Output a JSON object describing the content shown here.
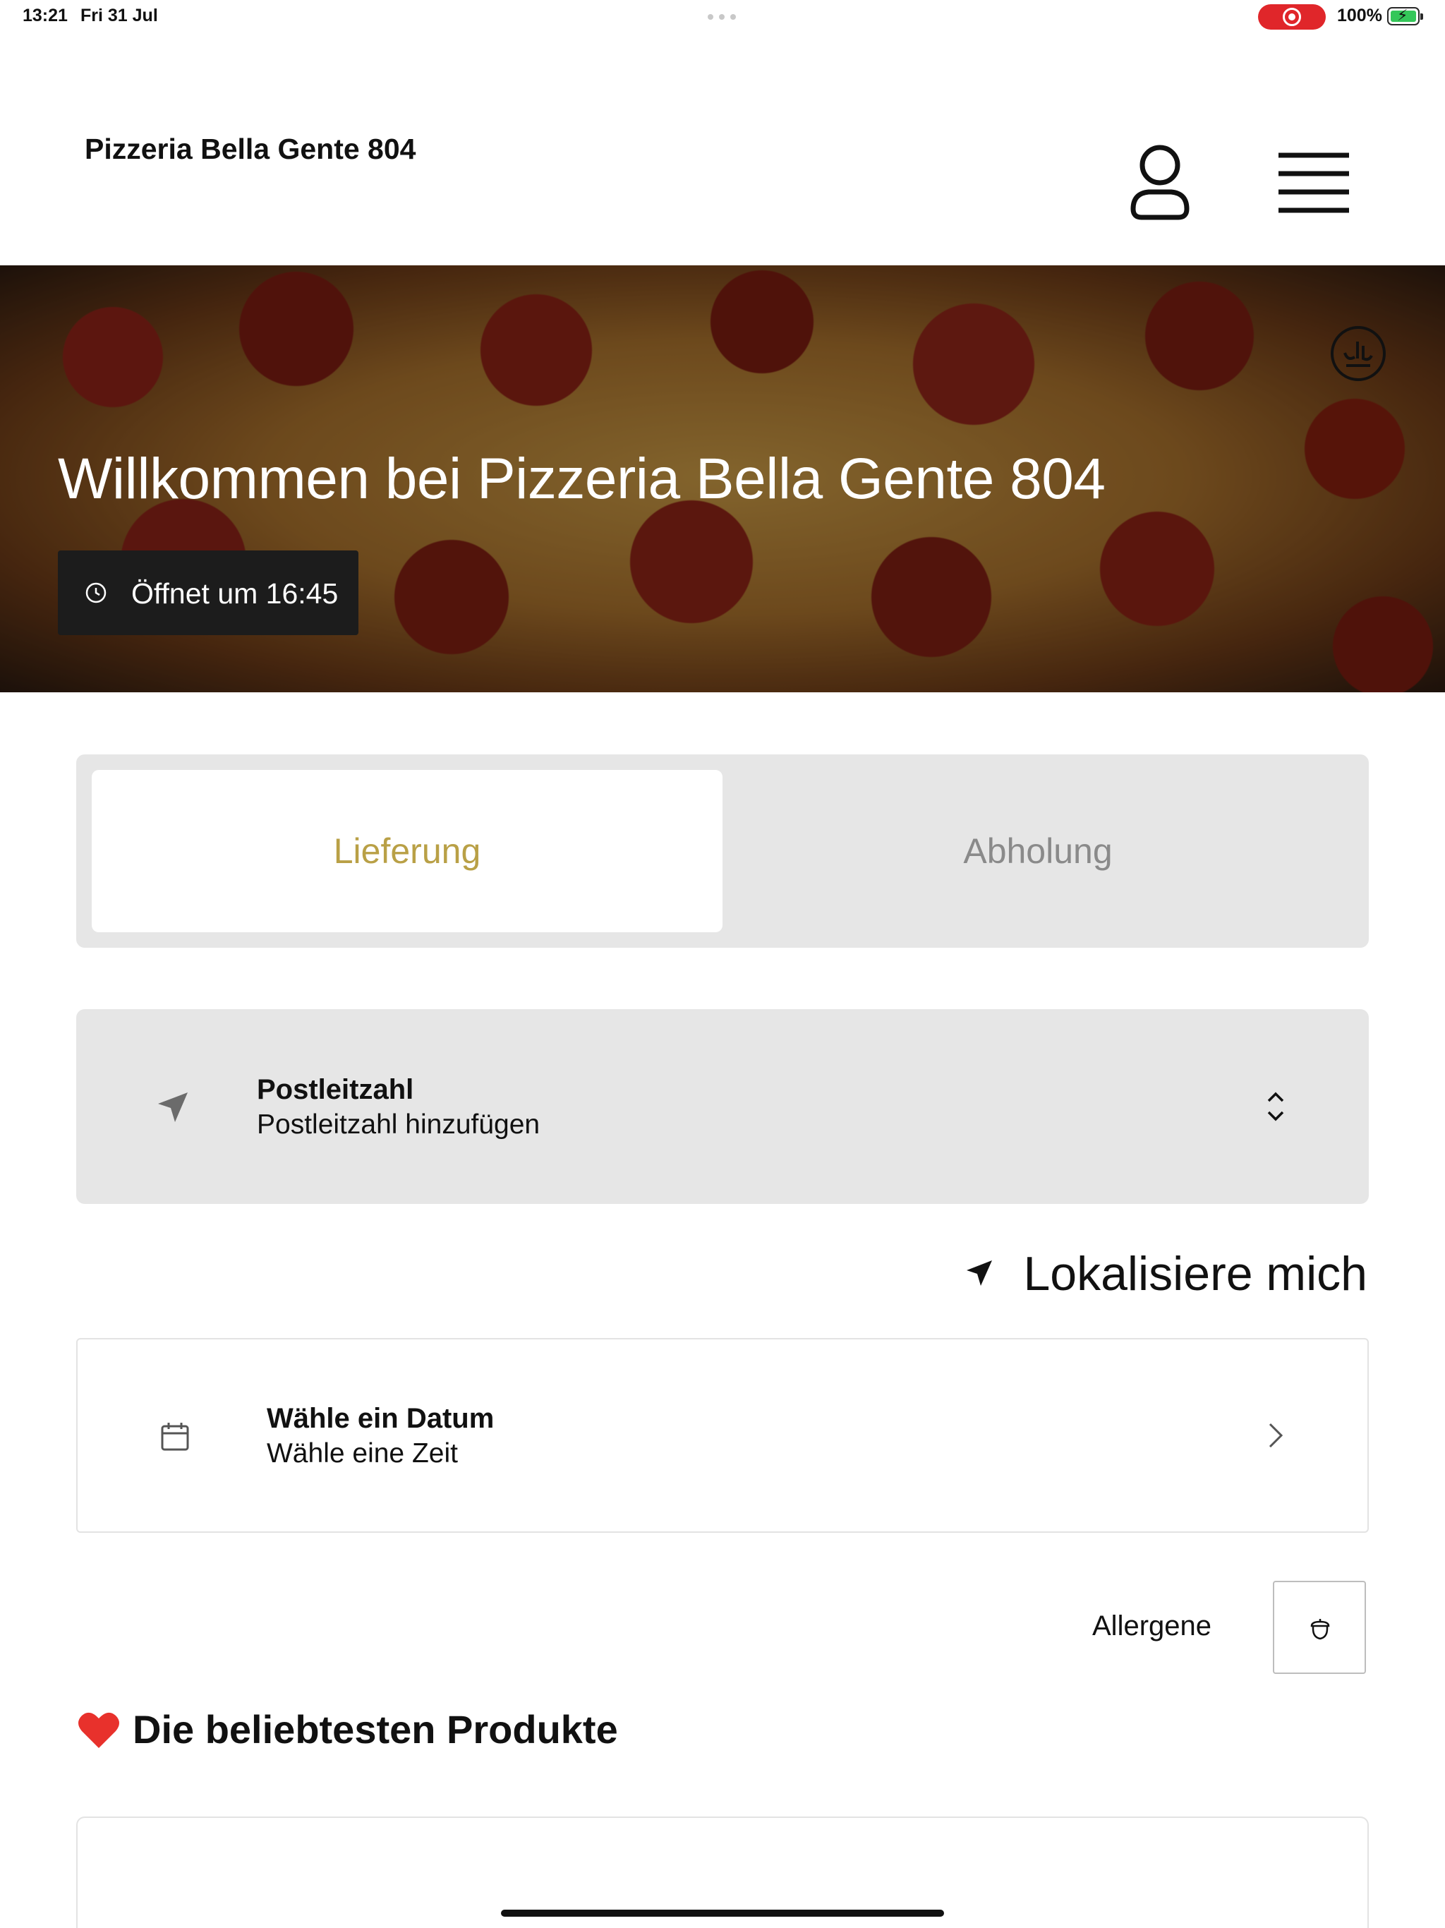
{
  "status_bar": {
    "time": "13:21",
    "date": "Fri 31 Jul",
    "battery": "100%",
    "recording_color": "#e0262a",
    "battery_fill_color": "#34c759"
  },
  "header": {
    "brand": "Pizzeria Bella Gente 804",
    "profile_icon": "user-icon",
    "menu_icon": "hamburger-menu-icon"
  },
  "hero": {
    "title": "Willkommen bei Pizzeria Bella Gente 804",
    "open_badge": "Öffnet um 16:45",
    "halal_icon": "halal-icon"
  },
  "order_mode": {
    "tabs": [
      {
        "label": "Lieferung",
        "selected": true
      },
      {
        "label": "Abholung",
        "selected": false
      }
    ],
    "accent_color": "#b9a046"
  },
  "postal": {
    "title": "Postleitzahl",
    "subtitle": "Postleitzahl hinzufügen"
  },
  "locate": {
    "label": "Lokalisiere mich"
  },
  "date_picker": {
    "title": "Wähle ein Datum",
    "subtitle": "Wähle eine Zeit"
  },
  "allergens": {
    "label": "Allergene",
    "icon": "acorn-icon"
  },
  "popular": {
    "title": "Die beliebtesten Produkte",
    "icon": "heart-icon"
  }
}
